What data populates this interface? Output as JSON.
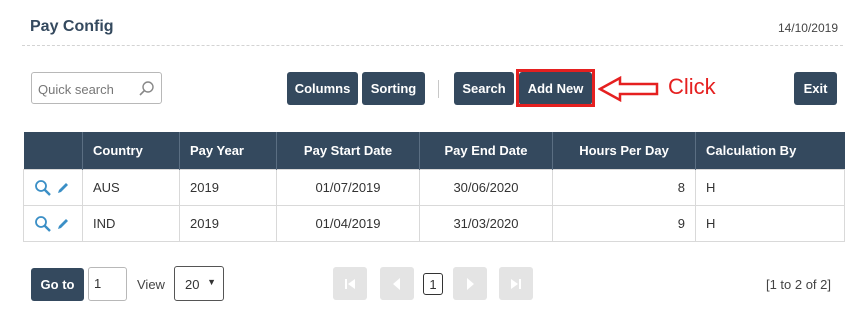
{
  "header": {
    "title": "Pay Config",
    "date": "14/10/2019"
  },
  "search": {
    "placeholder": "Quick search",
    "value": ""
  },
  "toolbar": {
    "columns_label": "Columns",
    "sorting_label": "Sorting",
    "search_label": "Search",
    "add_new_label": "Add New",
    "exit_label": "Exit"
  },
  "annotation": {
    "label": "Click",
    "color": "#e52020"
  },
  "table": {
    "columns": [
      "Country",
      "Pay Year",
      "Pay Start Date",
      "Pay End Date",
      "Hours Per Day",
      "Calculation By"
    ],
    "rows": [
      {
        "country": "AUS",
        "pay_year": "2019",
        "start": "01/07/2019",
        "end": "30/06/2020",
        "hours": "8",
        "calc": "H"
      },
      {
        "country": "IND",
        "pay_year": "2019",
        "start": "01/04/2019",
        "end": "31/03/2020",
        "hours": "9",
        "calc": "H"
      }
    ]
  },
  "pagination": {
    "goto_label": "Go to",
    "page_value": "1",
    "view_label": "View",
    "view_value": "20",
    "current_page": "1",
    "range_text": "[1 to 2 of 2]"
  },
  "colors": {
    "primary": "#34495e",
    "icon": "#3b8fc6",
    "accent": "#e52020"
  }
}
